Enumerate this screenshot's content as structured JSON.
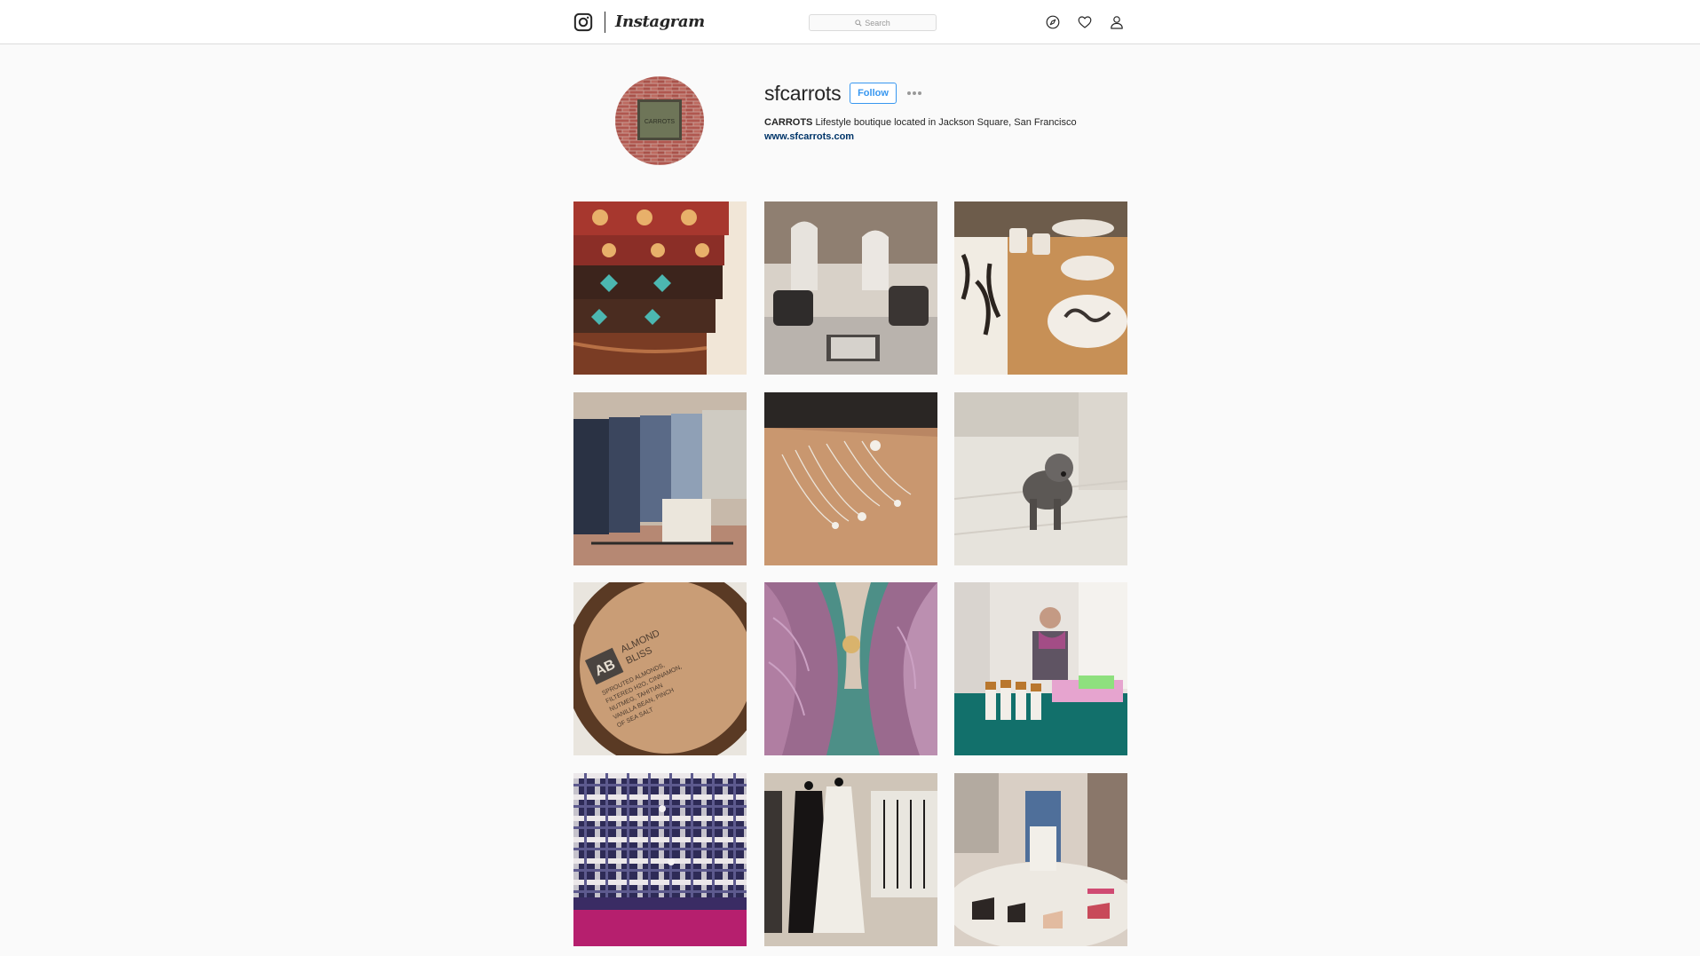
{
  "header": {
    "logo_text": "Instagram",
    "search_placeholder": "Search",
    "icons": [
      "instagram-glyph-icon",
      "search-icon",
      "compass-icon",
      "heart-icon",
      "profile-icon"
    ]
  },
  "profile": {
    "username": "sfcarrots",
    "follow_label": "Follow",
    "bio_name": "CARROTS",
    "bio_text": " Lifestyle boutique located in Jackson Square, San Francisco",
    "website": "www.sfcarrots.com",
    "avatar_sign_text": "CARROTS"
  },
  "colors": {
    "accent": "#3897f0",
    "link": "#003569",
    "background": "#fafafa",
    "border": "#dbdbdb"
  },
  "posts": [
    {
      "subject": "stacked tooled leather belts"
    },
    {
      "subject": "boutique display with bags and scarves"
    },
    {
      "subject": "ceramic vase and plates with coral print"
    },
    {
      "subject": "folded jeans on a bench"
    },
    {
      "subject": "necklaces laid on a table"
    },
    {
      "subject": "schnauzer dog on a tiled floor"
    },
    {
      "subject": "Almond Bliss bottle cap",
      "printed_text": [
        "AB",
        "ALMOND",
        "BLISS",
        "SPROUTED ALMONDS,",
        "FILTERED H2O, CINNAMON,",
        "NUTMEG, TAHITIAN",
        "VANILLA BEAN, PINCH",
        "OF SEA SALT"
      ]
    },
    {
      "subject": "knit scarf with pendant"
    },
    {
      "subject": "woman at a table with bottles"
    },
    {
      "subject": "plaid flannel shirts"
    },
    {
      "subject": "dresses on mannequins"
    },
    {
      "subject": "shoe display around a mannequin"
    }
  ]
}
